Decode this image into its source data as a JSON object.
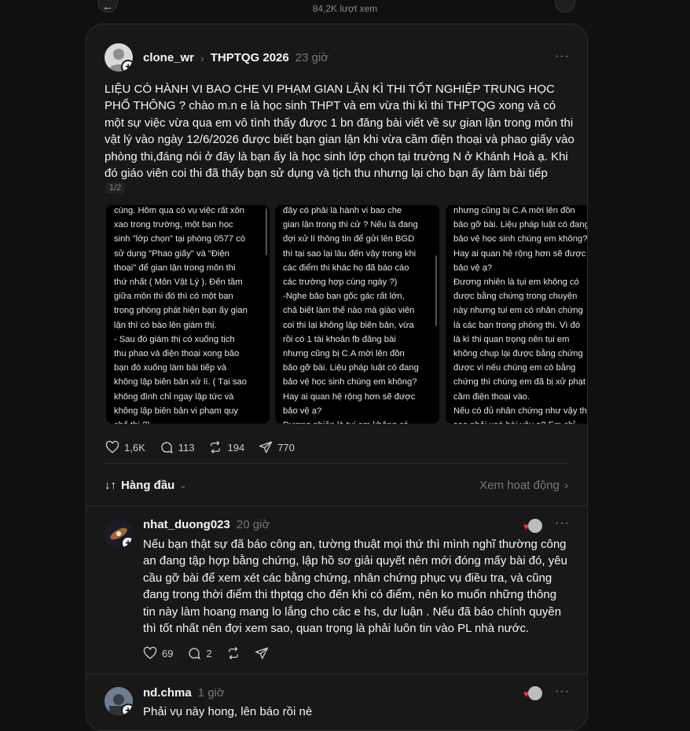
{
  "topbar": {
    "views": "84,2K lượt xem"
  },
  "post": {
    "username": "clone_wr",
    "community": "THPTQG 2026",
    "time": "23 giờ",
    "text": "LIỆU CÓ HÀNH VI BAO CHE VI PHẠM GIAN LẬN KÌ THI TỐT NGHIỆP TRUNG HỌC PHỔ THÔNG ? chào m.n e là học sinh THPT và em vừa thi kì thi THPTQG xong và có một sự việc vừa qua em vô tình thấy được 1 bn đăng bài viết về sự gian lận trong môn thi vật lý vào ngày 12/6/2026 được biết bạn gian lận khi vừa cầm điện thoại và phao giấy vào phòng thi,đáng nói ở đây là bạn ấy là học sinh lớp chọn tại trường N ở Khánh Hoà ạ. Khi đó giáo viên coi thi đã thấy bạn sử dụng và tịch thu nhưng lại cho bạn ấy làm bài tiếp",
    "pager": "1/2",
    "images": [
      {
        "lines": [
          "cùng. Hôm qua có vụ việc rất xôn",
          "xao trong trường, một bạn học",
          "sinh \"lớp chọn\" tại phòng 0577 có",
          "sử dụng \"Phao giấy\" và \"Điện",
          "thoại\" để gian lận trong môn thi",
          "thứ nhất ( Môn Vật Lý ). Đến tầm",
          "giữa môn thi đó thì có một bạn",
          "trong phòng phát hiện bạn ấy gian",
          "lận thì có báo lên giám thị.",
          "- Sau đó giám thị có xuống tịch",
          "thu phao và điện thoại xong bảo",
          "bạn đó xuống làm bài tiếp và",
          "không lập biên bản xử lí. ( Tại sao",
          "không đình chỉ ngay lập tức và",
          "không lập biên bản vi phạm quy",
          "chế thi ?)"
        ]
      },
      {
        "lines": [
          "đây có phải là hành vi bao che",
          "gian lận trong thi cử ? Nếu là đang",
          "đợi xử lí thông tin để gửi lên BGD",
          "thì tại sao lại lâu đến vậy trong khi",
          "các điểm thi khác họ đã báo cáo",
          "các trường hợp cùng ngày ?)",
          "-Nghe bảo bạn gốc gác rất lớn,",
          "chả biết làm thế nào mà giáo viên",
          "coi thi lại không lập biên bản, vừa",
          "rồi có 1 tài khoản fb đăng bài",
          "nhưng cũng bị C.A mời lên đồn",
          "bảo gỡ bài. Liệu pháp luật có đang",
          "bảo vệ học sinh chúng em không?",
          "Hay ai quan hệ rộng hơn sẽ được",
          "bảo vệ ạ?",
          "Đương nhiên là tụi em không có"
        ]
      },
      {
        "lines": [
          "nhưng cũng bị C.A mời lên đồn",
          "bảo gỡ bài. Liệu pháp luật có đang",
          "bảo vệ học sinh chúng em không?",
          "Hay ai quan hệ rộng hơn sẽ được",
          "bảo vệ ạ?",
          "Đương nhiên là tụi em không có",
          "được bằng chứng trong chuyện",
          "này nhưng tụi em có nhân chứng",
          "là các bạn trong phòng thi. Vì đó",
          "là kì thi quan trọng  nên tụi em",
          "không chụp lại được bằng chứng",
          "được vì nếu chúng em có bằng",
          "chứng thì chúng em đã bị xử phạt vì",
          "cầm điện thoại vào.",
          "Nếu có đủ nhân chứng như vậy thì",
          "sao phải xoá bài vậy ạ? Em chỉ"
        ]
      }
    ],
    "likes": "1,6K",
    "comments": "113",
    "reposts": "194",
    "shares": "770"
  },
  "sortbar": {
    "sort_label": "Hàng đầu",
    "activity_label": "Xem hoạt động"
  },
  "replies": [
    {
      "username": "nhat_duong023",
      "time": "20 giờ",
      "text": "Nếu bạn thật sự đã báo công an, tường thuật mọi thứ thì mình nghĩ thường công an đang tập hợp bằng chứng, lập hồ sơ giải quyết nên mới đóng mấy bài đó, yêu cầu gỡ bài để xem xét các bằng chứng, nhân chứng phục vụ điều tra, và cũng đang trong thời điểm thi thptqg cho đến khi có điểm, nên ko muốn những thông tin này làm hoang mang lo lắng cho các e hs, dư luận . Nếu đã báo chính quyền thì tốt nhất nên đợi xem sao, quan trọng là phải luôn tin vào PL nhà nước.",
      "likes": "69",
      "comments": "2"
    },
    {
      "username": "nd.chma",
      "time": "1 giờ",
      "text": "Phải vụ này hong, lên báo rồi nè"
    }
  ]
}
